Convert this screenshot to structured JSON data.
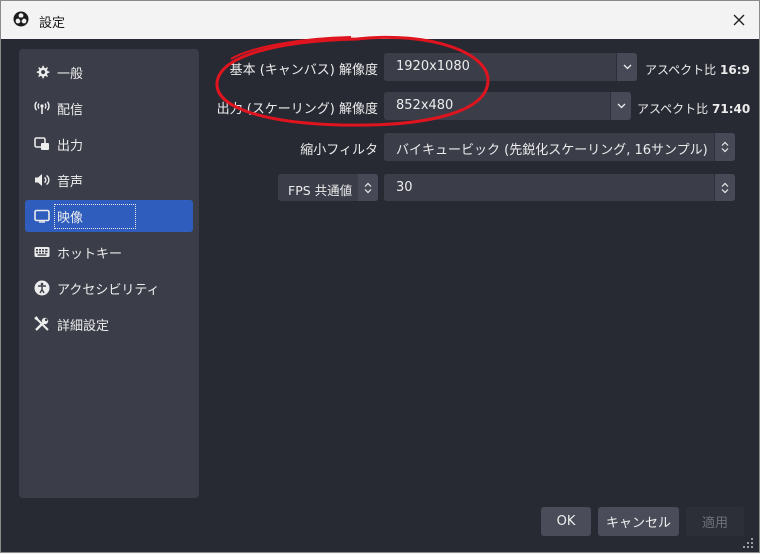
{
  "window": {
    "title": "設定"
  },
  "sidebar": {
    "items": [
      {
        "label": "一般",
        "icon": "gear-icon"
      },
      {
        "label": "配信",
        "icon": "broadcast-icon"
      },
      {
        "label": "出力",
        "icon": "output-icon"
      },
      {
        "label": "音声",
        "icon": "speaker-icon"
      },
      {
        "label": "映像",
        "icon": "monitor-icon",
        "active": true
      },
      {
        "label": "ホットキー",
        "icon": "keyboard-icon"
      },
      {
        "label": "アクセシビリティ",
        "icon": "accessibility-icon"
      },
      {
        "label": "詳細設定",
        "icon": "tools-icon"
      }
    ]
  },
  "video": {
    "base_resolution": {
      "label": "基本 (キャンバス) 解像度",
      "value": "1920x1080",
      "aspect_label": "アスペクト比",
      "aspect_value": "16:9"
    },
    "output_resolution": {
      "label": "出力 (スケーリング) 解像度",
      "value": "852x480",
      "aspect_label": "アスペクト比",
      "aspect_value": "71:40"
    },
    "downscale_filter": {
      "label": "縮小フィルタ",
      "value": "バイキュービック (先鋭化スケーリング, 16サンプル)"
    },
    "fps": {
      "mode_label": "FPS 共通値",
      "value": "30"
    }
  },
  "buttons": {
    "ok": "OK",
    "cancel": "キャンセル",
    "apply": "適用"
  },
  "colors": {
    "accent": "#2f5dbe",
    "annotation": "#e0141e",
    "background": "#272a33"
  }
}
